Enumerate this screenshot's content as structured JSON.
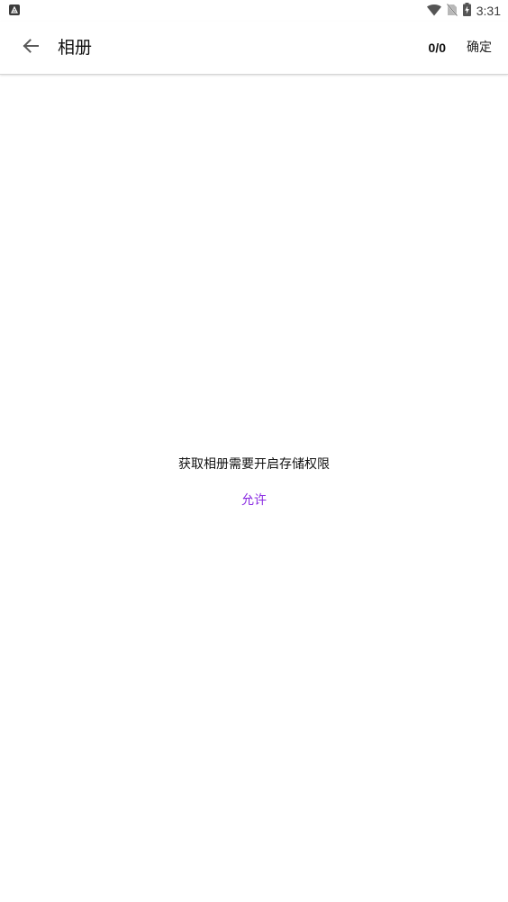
{
  "status_bar": {
    "time": "3:31",
    "left_icon": "app-notification-icon",
    "icons": [
      "wifi-icon",
      "no-sim-icon",
      "battery-charging-icon"
    ]
  },
  "header": {
    "title": "相册",
    "counter": "0/0",
    "confirm_label": "确定",
    "back_icon": "back-arrow-icon"
  },
  "permission": {
    "message": "获取相册需要开启存储权限",
    "allow_label": "允许"
  },
  "colors": {
    "accent": "#8a2be2",
    "background": "#ffffff",
    "text": "#111111"
  }
}
